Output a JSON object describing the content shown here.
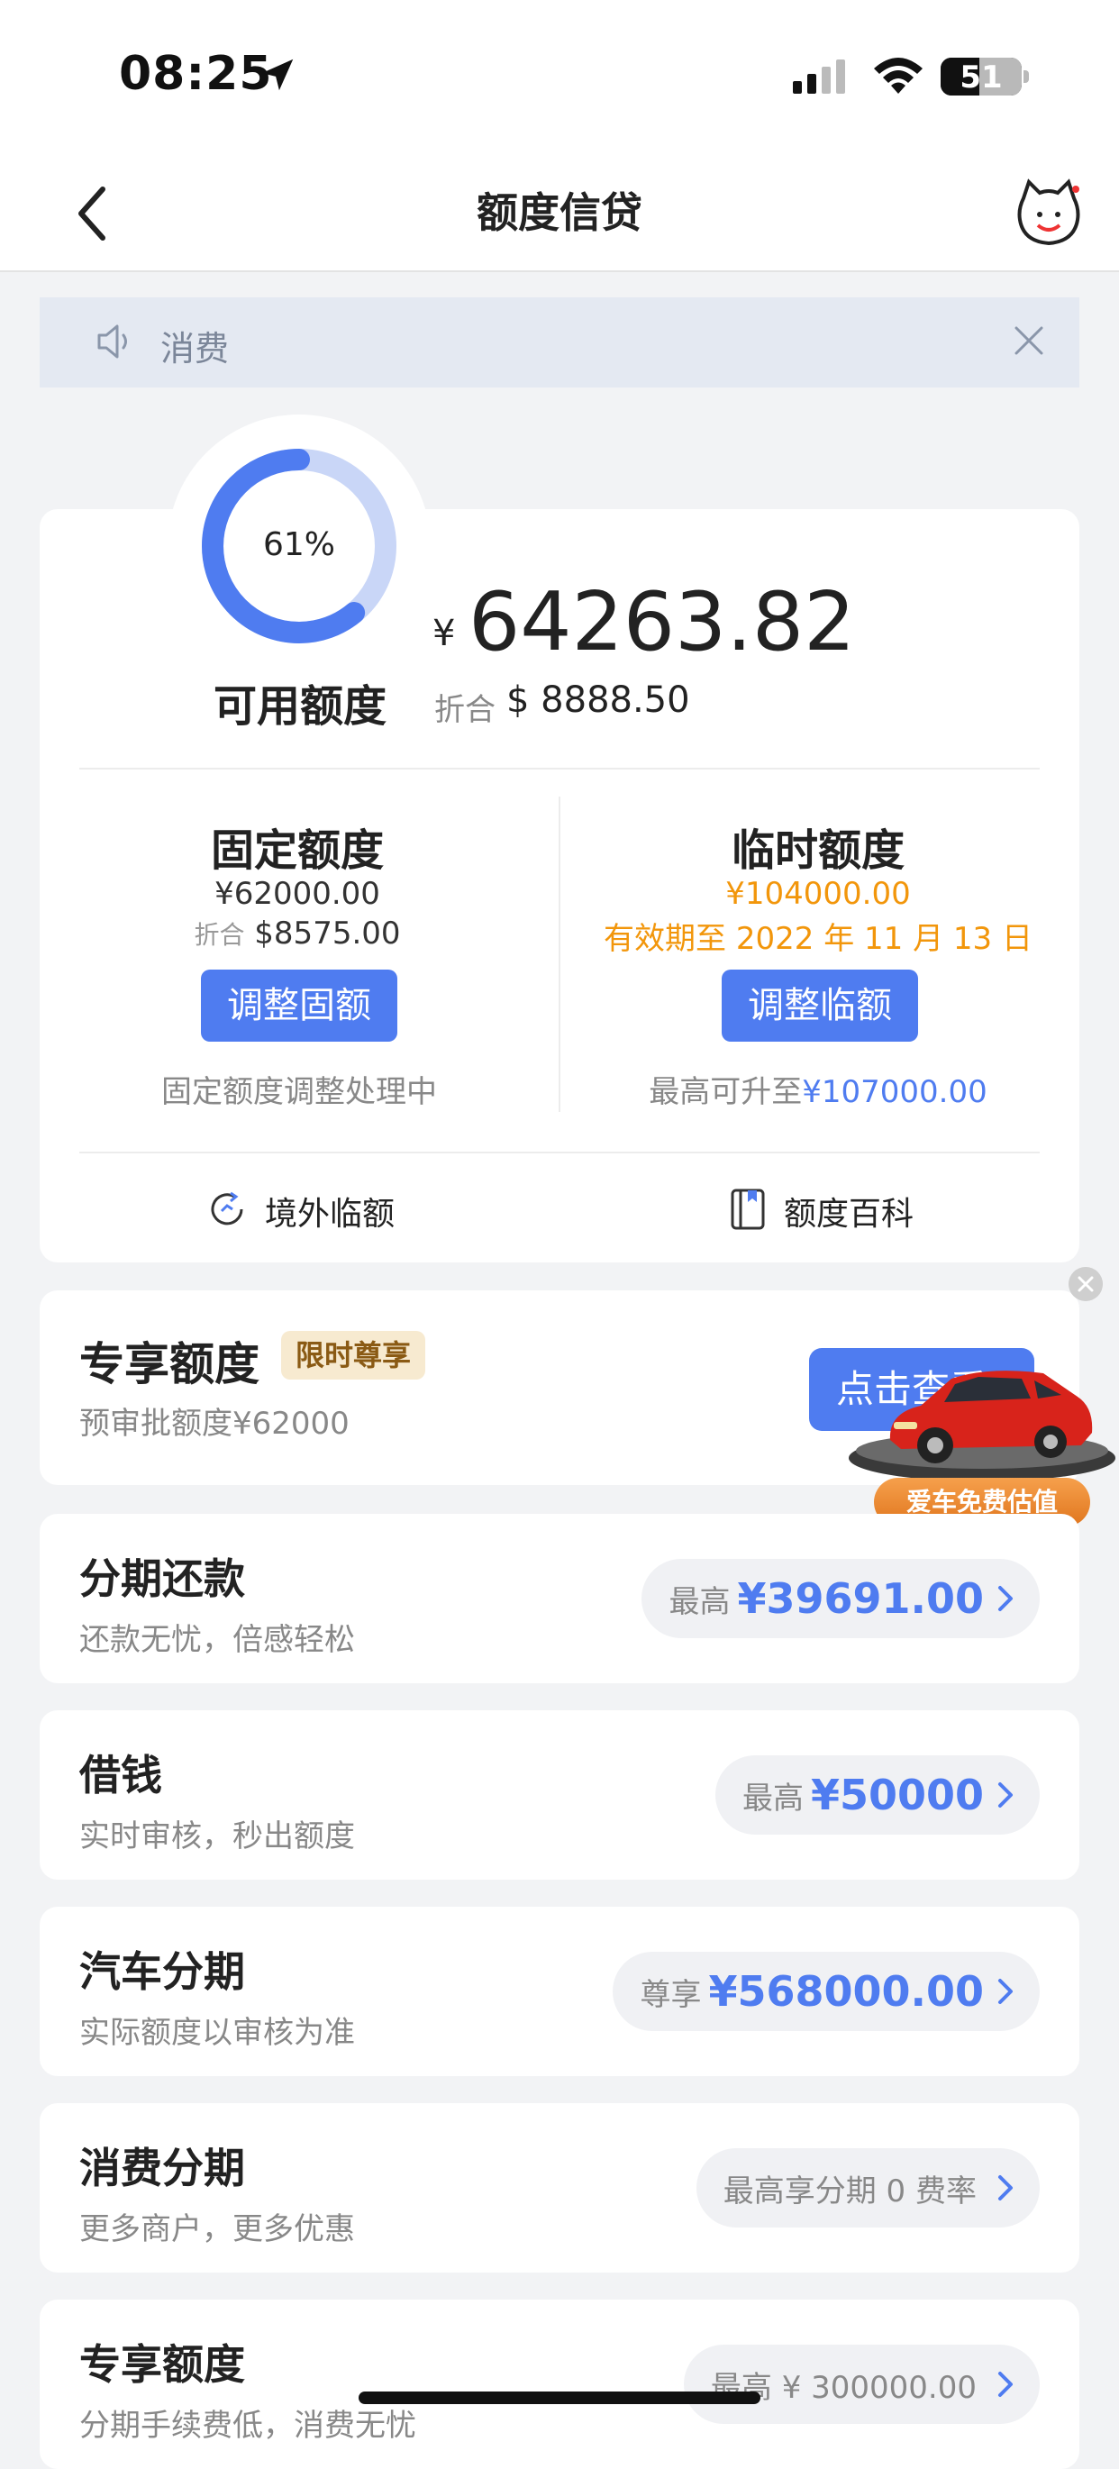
{
  "status_bar": {
    "time": "08:25",
    "battery": "51"
  },
  "header": {
    "title": "额度信贷"
  },
  "notice": {
    "text": "消费"
  },
  "summary": {
    "ring_percent_text": "61%",
    "ring_fraction": 0.61,
    "available_label": "可用额度",
    "currency_symbol": "¥",
    "available_amount": "64263.82",
    "converted_label": "折合",
    "converted_value": "$ 8888.50"
  },
  "fixed": {
    "title": "固定额度",
    "amount": "¥62000.00",
    "converted_label": "折合",
    "converted_value": "$8575.00",
    "button": "调整固额",
    "note": "固定额度调整处理中"
  },
  "temporary": {
    "title": "临时额度",
    "amount": "¥104000.00",
    "validity": "有效期至 2022 年 11 月 13 日",
    "button": "调整临额",
    "note_prefix": "最高可升至",
    "note_value": "¥107000.00"
  },
  "links": {
    "overseas": "境外临额",
    "wiki": "额度百科"
  },
  "exclusive": {
    "title": "专享额度",
    "badge": "限时尊享",
    "subtitle": "预审批额度¥62000",
    "button": "点击查看"
  },
  "car_ad": {
    "label": "爱车免费估值"
  },
  "items": [
    {
      "title": "分期还款",
      "subtitle": "还款无忧，倍感轻松",
      "pill_label": "最高",
      "pill_value": "¥39691.00"
    },
    {
      "title": "借钱",
      "subtitle": "实时审核，秒出额度",
      "pill_label": "最高",
      "pill_value": "¥50000"
    },
    {
      "title": "汽车分期",
      "subtitle": "实际额度以审核为准",
      "pill_label": "尊享",
      "pill_value": "¥568000.00"
    },
    {
      "title": "消费分期",
      "subtitle": "更多商户，更多优惠",
      "pill_label": "最高享分期 0 费率",
      "pill_value": ""
    },
    {
      "title": "专享额度",
      "subtitle": "分期手续费低，消费无忧",
      "pill_label": "最高 ¥ 300000.00",
      "pill_value": ""
    }
  ],
  "colors": {
    "accent": "#4f7cf0",
    "ring_track": "#c9d6f7",
    "warning": "#f2960b"
  }
}
